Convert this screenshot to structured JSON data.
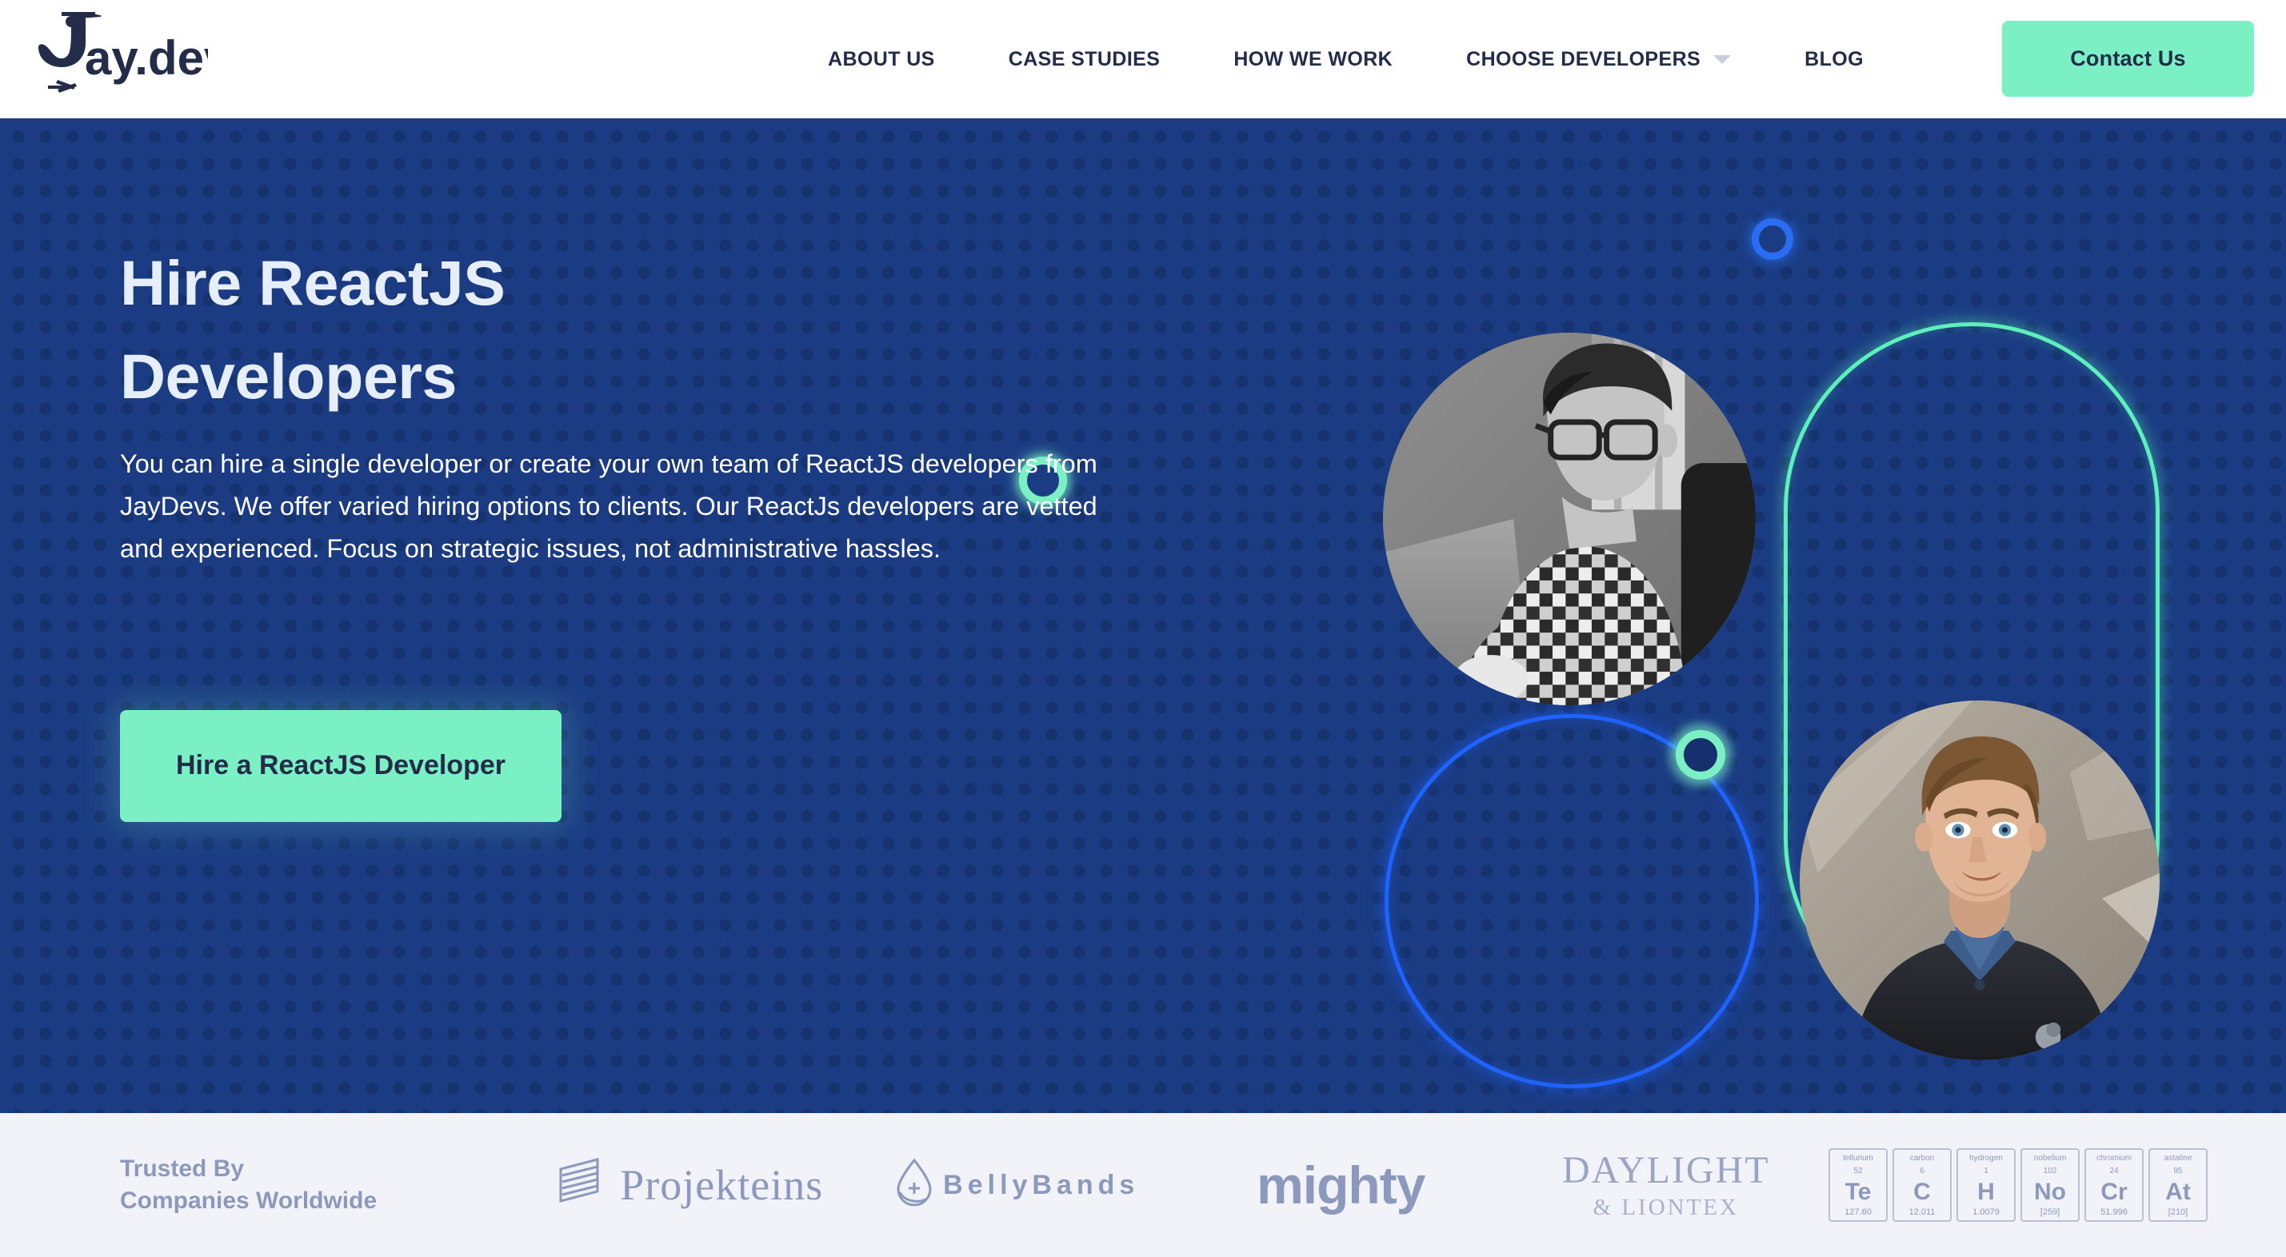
{
  "brand": {
    "name": "Jay.devs",
    "logo_icon": "jaybird-logo-icon"
  },
  "colors": {
    "navy": "#232c48",
    "hero_bg": "#1b3c83",
    "hero_dot": "#16336f",
    "mint": "#7bf0c4",
    "mint_outline": "#5df0bb",
    "blue_ring": "#1f63ff",
    "trusted_bg": "#f1f3f9",
    "muted_text": "#8d99bc"
  },
  "nav": {
    "items": [
      {
        "label": "ABOUT US",
        "has_dropdown": false
      },
      {
        "label": "CASE STUDIES",
        "has_dropdown": false
      },
      {
        "label": "HOW WE WORK",
        "has_dropdown": false
      },
      {
        "label": "CHOOSE DEVELOPERS",
        "has_dropdown": true
      },
      {
        "label": "BLOG",
        "has_dropdown": false
      }
    ],
    "cta_label": "Contact Us"
  },
  "hero": {
    "title_line1": "Hire ReactJS",
    "title_line2": "Developers",
    "paragraph": "You can hire a single developer or create your own team of ReactJS developers from JayDevs. We offer varied hiring options to clients. Our ReactJs developers are vetted and experienced. Focus on strategic issues, not administrative hassles.",
    "cta_label": "Hire a ReactJS Developer",
    "photo_top_alt": "developer-with-glasses-at-laptop",
    "photo_bottom_alt": "smiling-developer-portrait"
  },
  "trusted": {
    "label_line1": "Trusted By",
    "label_line2": "Companies Worldwide",
    "logos": [
      {
        "name": "Projekteins",
        "icon": "striped-parallelogram-icon"
      },
      {
        "name": "BellyBands",
        "icon": "water-droplet-plus-icon"
      },
      {
        "name": "mighty",
        "icon": ""
      },
      {
        "name": "DAYLIGHT",
        "subtitle": "& LIONTEX",
        "icon": ""
      },
      {
        "name": "TECHNOCRAT",
        "icon": "periodic-table-tiles"
      }
    ],
    "technocrat_elements": [
      {
        "element_name": "tellurium",
        "number": "52",
        "symbol": "Te",
        "mass": "127.60"
      },
      {
        "element_name": "carbon",
        "number": "6",
        "symbol": "C",
        "mass": "12.011"
      },
      {
        "element_name": "hydrogen",
        "number": "1",
        "symbol": "H",
        "mass": "1.0079"
      },
      {
        "element_name": "nobelium",
        "number": "102",
        "symbol": "No",
        "mass": "[259]"
      },
      {
        "element_name": "chromium",
        "number": "24",
        "symbol": "Cr",
        "mass": "51.996"
      },
      {
        "element_name": "astatine",
        "number": "85",
        "symbol": "At",
        "mass": "[210]"
      }
    ]
  }
}
